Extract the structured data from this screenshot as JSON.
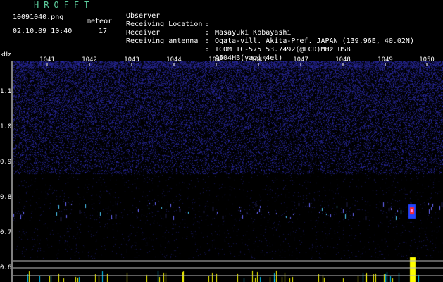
{
  "header": {
    "brand": "HROFFT",
    "filename": "10091040.png",
    "datetime": "02.10.09 10:40",
    "meteor_label": "meteor",
    "meteor_count": "17"
  },
  "info": [
    {
      "key": "Observer",
      "value": "Masayuki Kobayashi"
    },
    {
      "key": "Receiving Location",
      "value": "Ogata-vill. Akita-Pref. JAPAN (139.96E, 40.02N)"
    },
    {
      "key": "Receiver",
      "value": "ICOM IC-575 53.7492(@LCD)MHz USB"
    },
    {
      "key": "Receiving antenna",
      "value": "A504HB(yagi 4el)"
    }
  ],
  "axis": {
    "freq_unit": "kHz",
    "minute_labels": [
      "1041",
      "1042",
      "1043",
      "1044",
      "1045",
      "1046",
      "1047",
      "1048",
      "1049",
      "1050"
    ],
    "freq_labels": [
      "1.1",
      "1.0",
      "0.9",
      "0.8",
      "0.7",
      "0.6"
    ]
  },
  "colors": {
    "background": "#000000",
    "noise": "#1a1a6e",
    "brand": "#5fd1a0",
    "echo_strong": "#ff3030",
    "baseline_line": "#bdbdbd",
    "level_bars": "#ffff00",
    "level_secondary": "#00ccff"
  }
}
